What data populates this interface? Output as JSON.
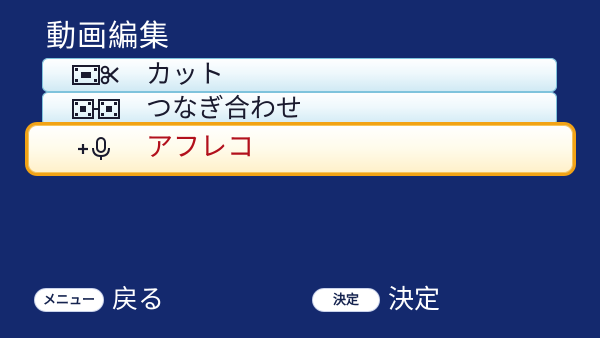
{
  "header": {
    "title": "動画編集"
  },
  "menu": {
    "items": [
      {
        "label": "カット",
        "icon": "cut-scissors-icon"
      },
      {
        "label": "つなぎ合わせ",
        "icon": "join-film-icon"
      },
      {
        "label": "アフレコ",
        "icon": "add-microphone-icon",
        "selected": true
      }
    ]
  },
  "footer": {
    "back": {
      "key": "メニュー",
      "label": "戻る"
    },
    "confirm": {
      "key": "決定",
      "label": "決定"
    }
  },
  "colors": {
    "background": "#14296e",
    "item_bg": "#eaf6fb",
    "selected_border": "#f2a316",
    "selected_text": "#b2101c"
  }
}
